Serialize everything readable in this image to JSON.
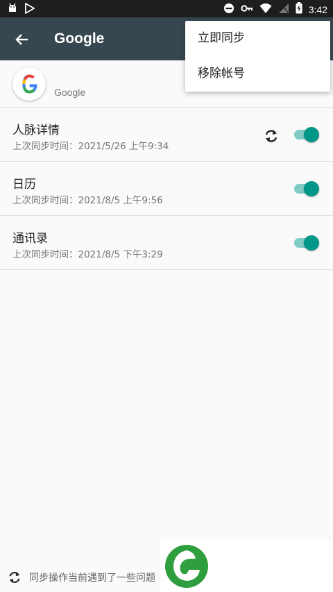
{
  "status_bar": {
    "time": "3:42",
    "left_icons": [
      "android-icon",
      "play-store-icon"
    ],
    "right_icons": [
      "do-not-disturb-icon",
      "vpn-key-icon",
      "wifi-icon",
      "no-signal-icon",
      "battery-icon"
    ]
  },
  "toolbar": {
    "title": "Google"
  },
  "account": {
    "name": "Google"
  },
  "sync_items": [
    {
      "title": "人脉详情",
      "subtitle": "上次同步时间：2021/5/26 上午9:34",
      "syncing": true,
      "enabled": true
    },
    {
      "title": "日历",
      "subtitle": "上次同步时间：2021/8/5 上午9:56",
      "syncing": false,
      "enabled": true
    },
    {
      "title": "通讯录",
      "subtitle": "上次同步时间：2021/8/5 下午3:29",
      "syncing": false,
      "enabled": true
    }
  ],
  "menu": {
    "items": [
      {
        "label": "立即同步"
      },
      {
        "label": "移除帐号"
      }
    ]
  },
  "footer": {
    "text": "同步操作当前遇到了一些问题"
  },
  "colors": {
    "toolbar": "#37474f",
    "status_bar": "#1e1e1e",
    "toggle_on": "#009688",
    "toggle_track": "#80cbc4",
    "watermark_green": "#2e9e3e"
  }
}
